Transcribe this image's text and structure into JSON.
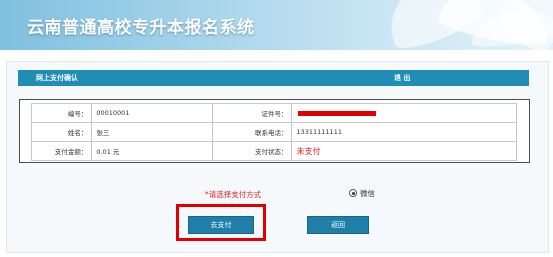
{
  "banner": {
    "title": "云南普通高校专升本报名系统"
  },
  "panel": {
    "title": "网上支付确认",
    "logout_label": "退 出"
  },
  "info": {
    "number_label": "编号：",
    "number_value": "00010001",
    "id_label": "证件号：",
    "name_label": "姓名：",
    "name_value": "张三",
    "phone_label": "联系电话：",
    "phone_value": "13311111111",
    "amount_label": "支付金额：",
    "amount_value": "0.01 元",
    "status_label": "支付状态：",
    "status_value": "未支付"
  },
  "payment": {
    "prompt": "*请选择支付方式",
    "option_wechat": "微信"
  },
  "buttons": {
    "pay_label": "去支付",
    "back_label": "返回"
  },
  "colors": {
    "header_blue": "#1f8db6",
    "button_blue": "#1f7fa8",
    "alert_red": "#e02020",
    "highlight_red": "#e00000"
  }
}
